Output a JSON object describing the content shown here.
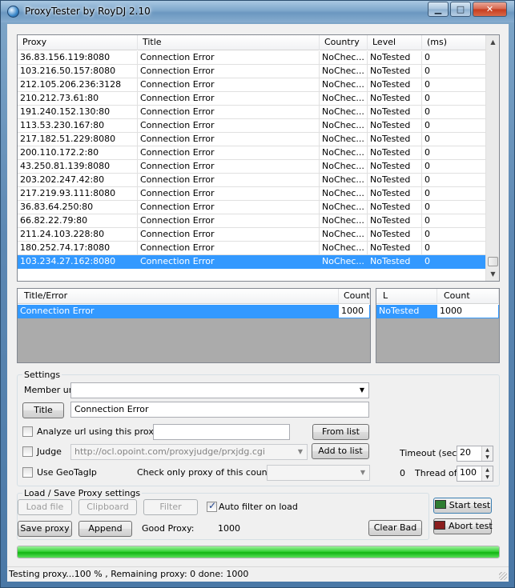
{
  "window": {
    "title": "ProxyTester by RoyDJ 2.10",
    "minimize": "▁",
    "maximize": "□",
    "close": "✕"
  },
  "proxy_table": {
    "columns": [
      "Proxy",
      "Title",
      "Country",
      "Level",
      "(ms)"
    ],
    "rows": [
      [
        "36.83.156.119:8080",
        "Connection Error",
        "NoChec...",
        "NoTested",
        "0"
      ],
      [
        "103.216.50.157:8080",
        "Connection Error",
        "NoChec...",
        "NoTested",
        "0"
      ],
      [
        "212.105.206.236:3128",
        "Connection Error",
        "NoChec...",
        "NoTested",
        "0"
      ],
      [
        "210.212.73.61:80",
        "Connection Error",
        "NoChec...",
        "NoTested",
        "0"
      ],
      [
        "191.240.152.130:80",
        "Connection Error",
        "NoChec...",
        "NoTested",
        "0"
      ],
      [
        "113.53.230.167:80",
        "Connection Error",
        "NoChec...",
        "NoTested",
        "0"
      ],
      [
        "217.182.51.229:8080",
        "Connection Error",
        "NoChec...",
        "NoTested",
        "0"
      ],
      [
        "200.110.172.2:80",
        "Connection Error",
        "NoChec...",
        "NoTested",
        "0"
      ],
      [
        "43.250.81.139:8080",
        "Connection Error",
        "NoChec...",
        "NoTested",
        "0"
      ],
      [
        "203.202.247.42:80",
        "Connection Error",
        "NoChec...",
        "NoTested",
        "0"
      ],
      [
        "217.219.93.111:8080",
        "Connection Error",
        "NoChec...",
        "NoTested",
        "0"
      ],
      [
        "36.83.64.250:80",
        "Connection Error",
        "NoChec...",
        "NoTested",
        "0"
      ],
      [
        "66.82.22.79:80",
        "Connection Error",
        "NoChec...",
        "NoTested",
        "0"
      ],
      [
        "211.24.103.228:80",
        "Connection Error",
        "NoChec...",
        "NoTested",
        "0"
      ],
      [
        "180.252.74.17:8080",
        "Connection Error",
        "NoChec...",
        "NoTested",
        "0"
      ],
      [
        "103.234.27.162:8080",
        "Connection Error",
        "NoChec...",
        "NoTested",
        "0"
      ]
    ],
    "selected_index": 15
  },
  "error_table": {
    "columns": [
      "Title/Error",
      "Count"
    ],
    "rows": [
      [
        "Connection Error",
        "1000"
      ]
    ]
  },
  "level_table": {
    "columns": [
      "L",
      "Count"
    ],
    "rows": [
      [
        "NoTested",
        "1000"
      ]
    ]
  },
  "settings": {
    "group_label": "Settings",
    "member_url_label": "Member url",
    "member_url_value": "",
    "title_button": "Title",
    "title_value": "Connection Error",
    "analyze_label": "Analyze url using this proxy :",
    "analyze_value": "",
    "from_list_button": "From list",
    "judge_label": "Judge",
    "judge_value": "http://ocl.opoint.com/proxyjudge/prxjdg.cgi",
    "add_to_list_button": "Add to list",
    "geotag_label": "Use GeoTagIp",
    "country_label": "Check only proxy of this country",
    "country_value": "",
    "timeout_label": "Timeout (sec)",
    "timeout_value": "20",
    "thread_count": "0",
    "thread_label": "Thread of",
    "thread_value": "100"
  },
  "load_save": {
    "group_label": "Load / Save  Proxy settings",
    "load_file": "Load file",
    "clipboard": "Clipboard",
    "filter": "Filter",
    "auto_filter_label": "Auto filter on load",
    "save_proxy": "Save proxy",
    "append": "Append",
    "good_proxy_label": "Good Proxy:",
    "good_proxy_value": "1000",
    "clear_bad": "Clear Bad"
  },
  "actions": {
    "start_test": "Start test",
    "abort_test": "Abort test"
  },
  "progress": {
    "percent": 100
  },
  "status": {
    "text": "Testing proxy...100 % , Remaining proxy: 0 done: 1000"
  },
  "colors": {
    "selection": "#3399ff",
    "progress_green": "#13b513"
  }
}
